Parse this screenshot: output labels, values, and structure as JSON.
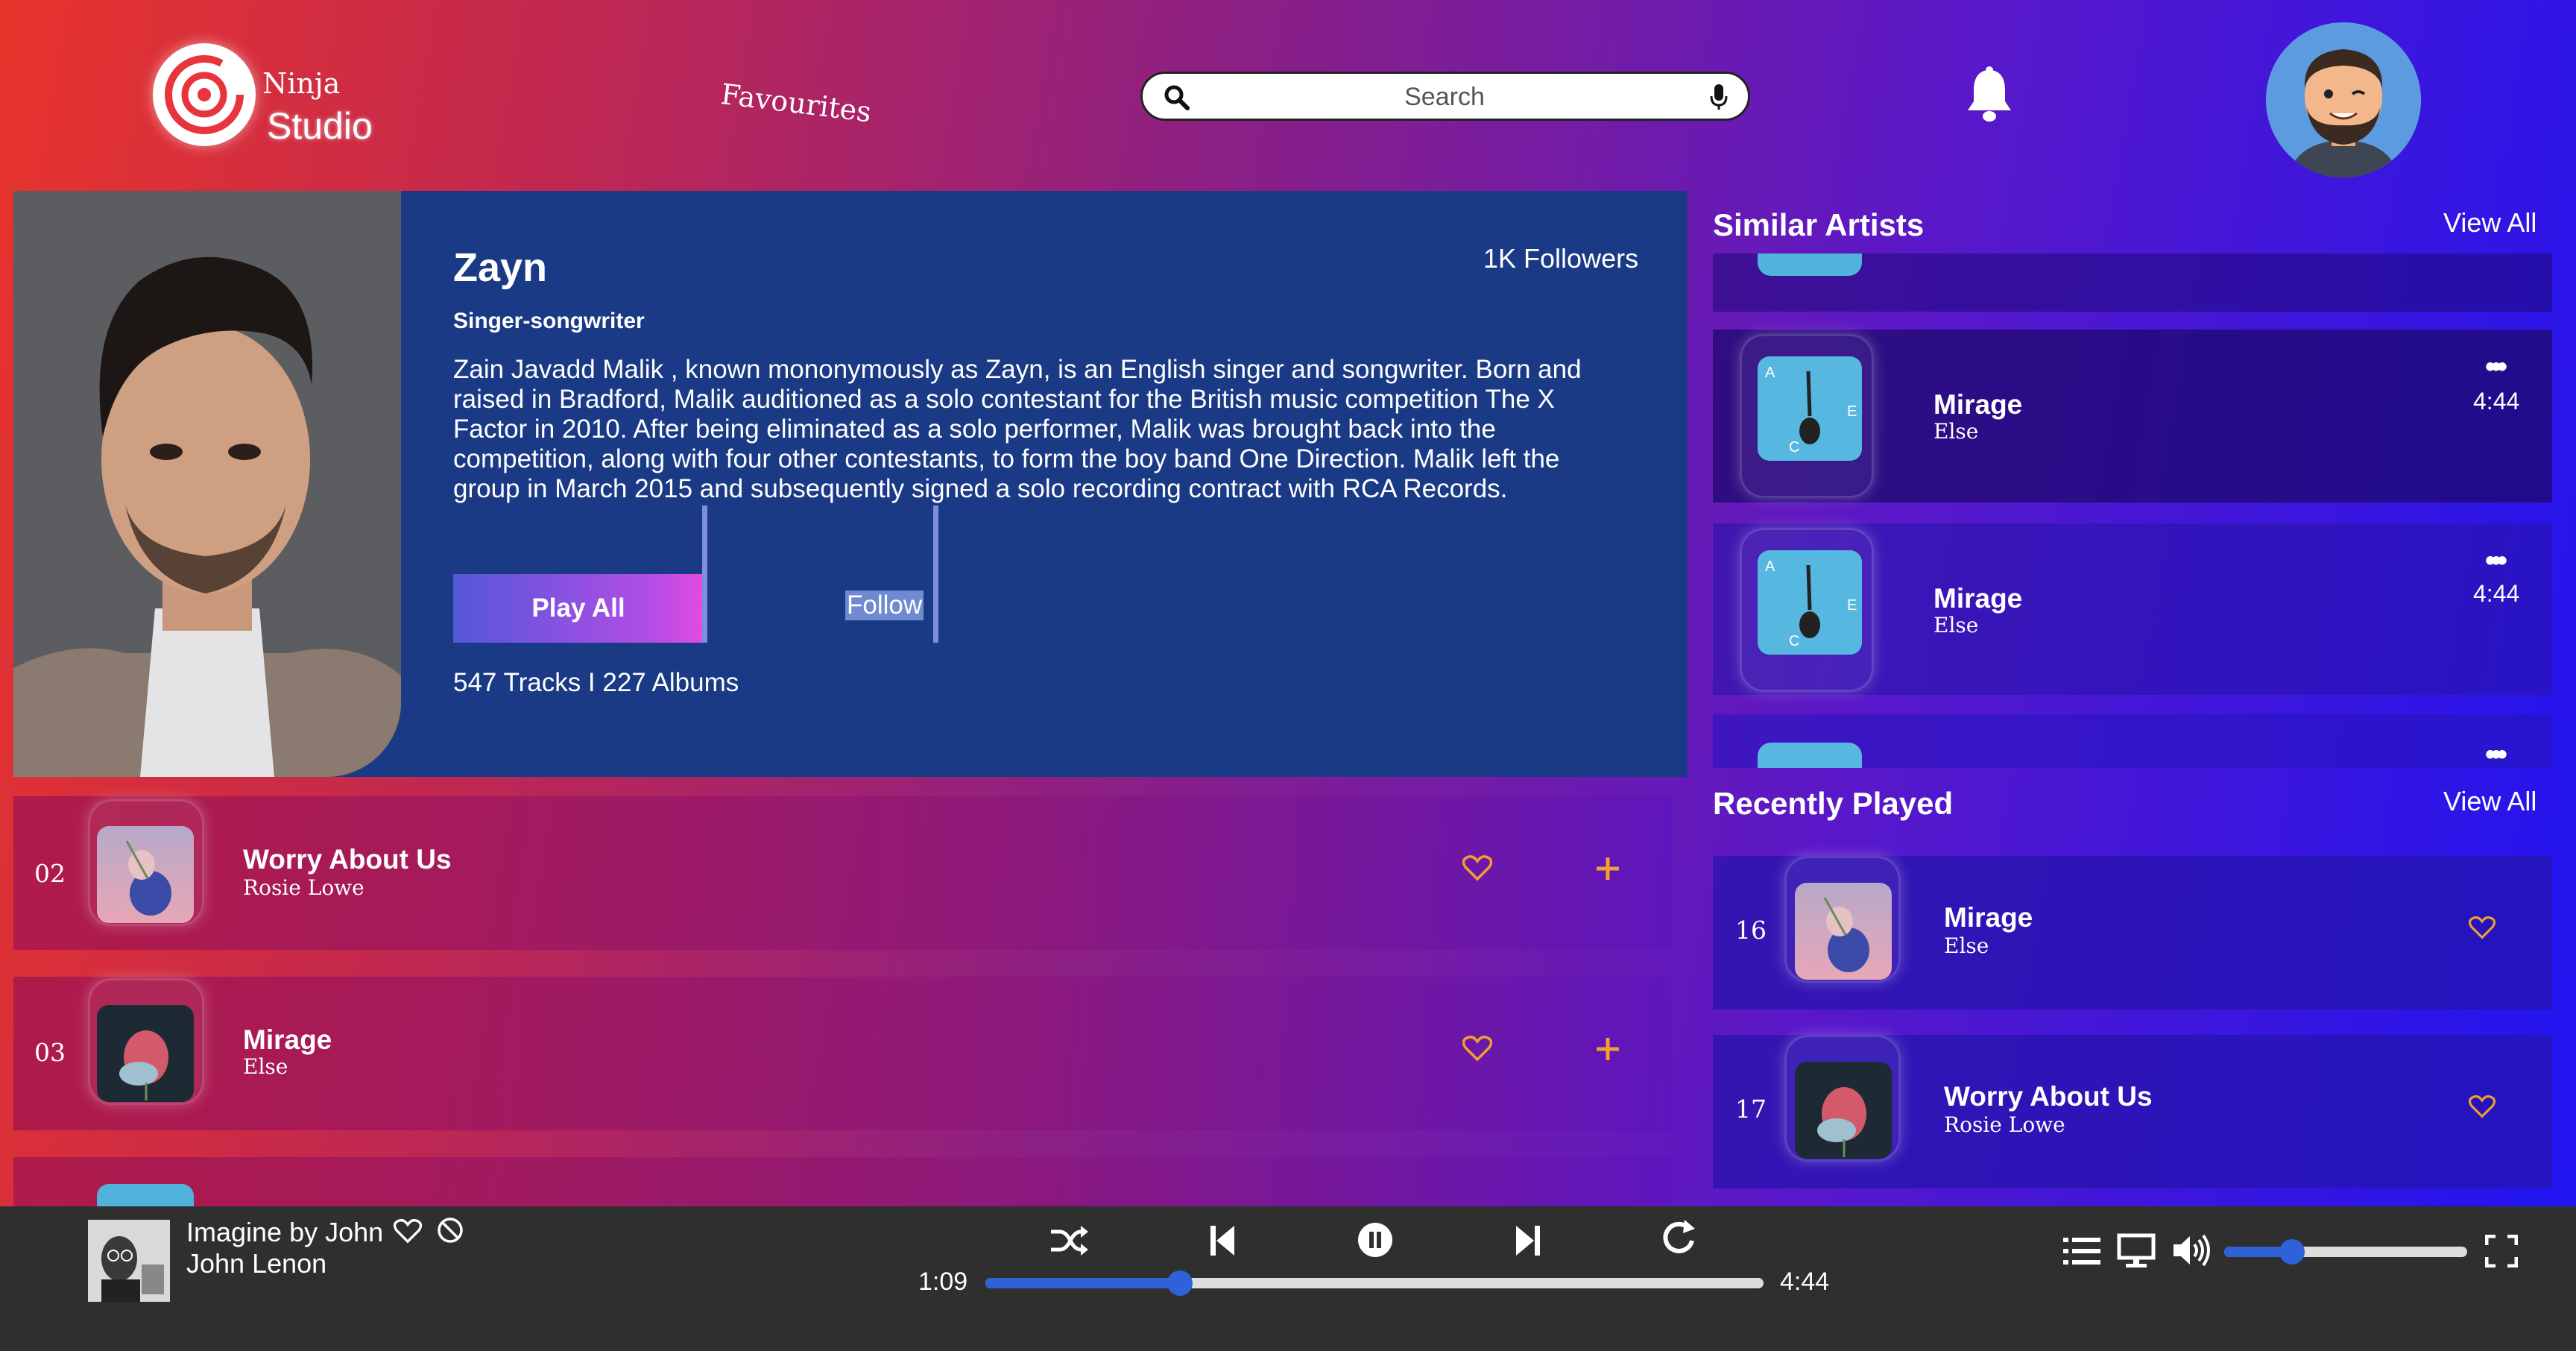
{
  "header": {
    "logo_top": "Ninja",
    "logo_bottom": "Studio",
    "nav_favourites": "Favourites",
    "search_placeholder": "Search"
  },
  "artist": {
    "name": "Zayn",
    "followers": "1K Followers",
    "role": "Singer-songwriter",
    "bio": "Zain Javadd Malik , known mononymously as Zayn, is an English singer and songwriter. Born and raised in Bradford, Malik auditioned as a solo contestant for the British music competition The X Factor in 2010. After being eliminated as a solo performer, Malik was brought back into the competition, along with four other contestants, to form the boy band One Direction. Malik left the group in March 2015 and subsequently signed a solo recording contract with RCA Records.",
    "play_all_label": "Play All",
    "follow_label": "Follow",
    "counts": "547 Tracks I 227 Albums"
  },
  "tracks": [
    {
      "num": "02",
      "title": "Worry About Us",
      "artist": "Rosie Lowe"
    },
    {
      "num": "03",
      "title": "Mirage",
      "artist": "Else"
    }
  ],
  "similar_artists": {
    "title": "Similar Artists",
    "view_all": "View All",
    "items": [
      {
        "title": "Mirage",
        "artist": "Else",
        "duration": "4:44"
      },
      {
        "title": "Mirage",
        "artist": "Else",
        "duration": "4:44"
      }
    ]
  },
  "recently_played": {
    "title": "Recently Played",
    "view_all": "View All",
    "items": [
      {
        "num": "16",
        "title": "Mirage",
        "artist": "Else"
      },
      {
        "num": "17",
        "title": "Worry About Us",
        "artist": "Rosie Lowe"
      }
    ]
  },
  "player": {
    "track_title": "Imagine by John",
    "track_artist": "John Lenon",
    "current_time": "1:09",
    "total_time": "4:44",
    "progress": 0.25,
    "volume": 0.28
  },
  "colors": {
    "accent_blue": "#2f62d8",
    "heart_orange": "#f0a030",
    "artist_panel": "#1b3a86"
  }
}
